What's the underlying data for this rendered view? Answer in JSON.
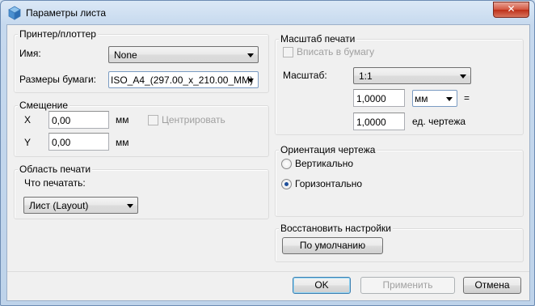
{
  "window": {
    "title": "Параметры листа",
    "close_glyph": "✕",
    "app_icon": "cube-icon"
  },
  "printer": {
    "legend": "Принтер/плоттер",
    "name_label": "Имя:",
    "name_value": "None",
    "paper_label": "Размеры бумаги:",
    "paper_value": "ISO_A4_(297.00_x_210.00_MM)"
  },
  "offset": {
    "legend": "Смещение",
    "x_label": "X",
    "x_value": "0,00",
    "x_unit": "мм",
    "y_label": "Y",
    "y_value": "0,00",
    "y_unit": "мм",
    "center_label": "Центрировать",
    "center_checked": false
  },
  "print_area": {
    "legend": "Область печати",
    "what_label": "Что печатать:",
    "what_value": "Лист (Layout)"
  },
  "scale": {
    "legend": "Масштаб печати",
    "fit_label": "Вписать в бумагу",
    "fit_checked": false,
    "scale_label": "Масштаб:",
    "scale_value": "1:1",
    "value1": "1,0000",
    "unit_value": "мм",
    "equals": "=",
    "value2": "1,0000",
    "drawing_units": "ед. чертежа"
  },
  "orientation": {
    "legend": "Ориентация чертежа",
    "portrait_label": "Вертикально",
    "landscape_label": "Горизонтально",
    "selected": "landscape"
  },
  "restore": {
    "legend": "Восстановить настройки",
    "default_button": "По умолчанию"
  },
  "buttons": {
    "ok": "OK",
    "apply": "Применить",
    "cancel": "Отмена"
  }
}
